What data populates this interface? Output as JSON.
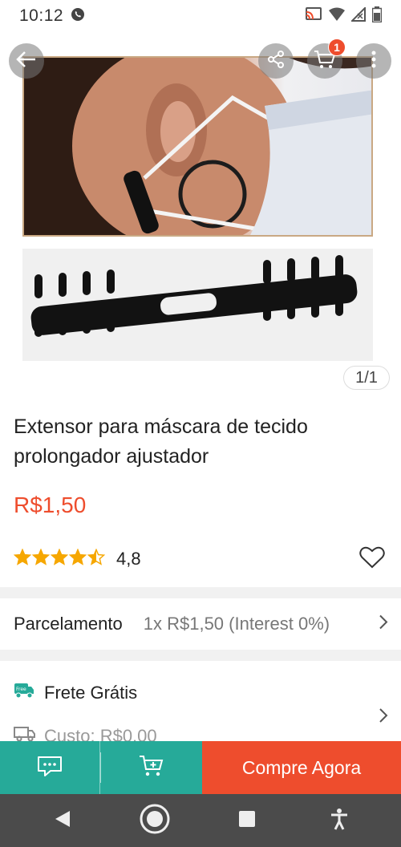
{
  "status_bar": {
    "time": "10:12"
  },
  "image": {
    "counter": "1/1",
    "cart_badge": "1"
  },
  "product": {
    "title": "Extensor para máscara de tecido prolongador ajustador",
    "price": "R$1,50",
    "rating": "4,8",
    "stars_filled": 4.5
  },
  "installment": {
    "label": "Parcelamento",
    "value": "1x R$1,50 (Interest 0%)"
  },
  "shipping": {
    "free_label": "Frete Grátis",
    "free_badge": "Free",
    "cost_label": "Custo: R$0,00"
  },
  "actions": {
    "buy_label": "Compre Agora"
  },
  "colors": {
    "accent": "#ee4d2d",
    "teal": "#26aa99",
    "star": "#f6a700"
  }
}
